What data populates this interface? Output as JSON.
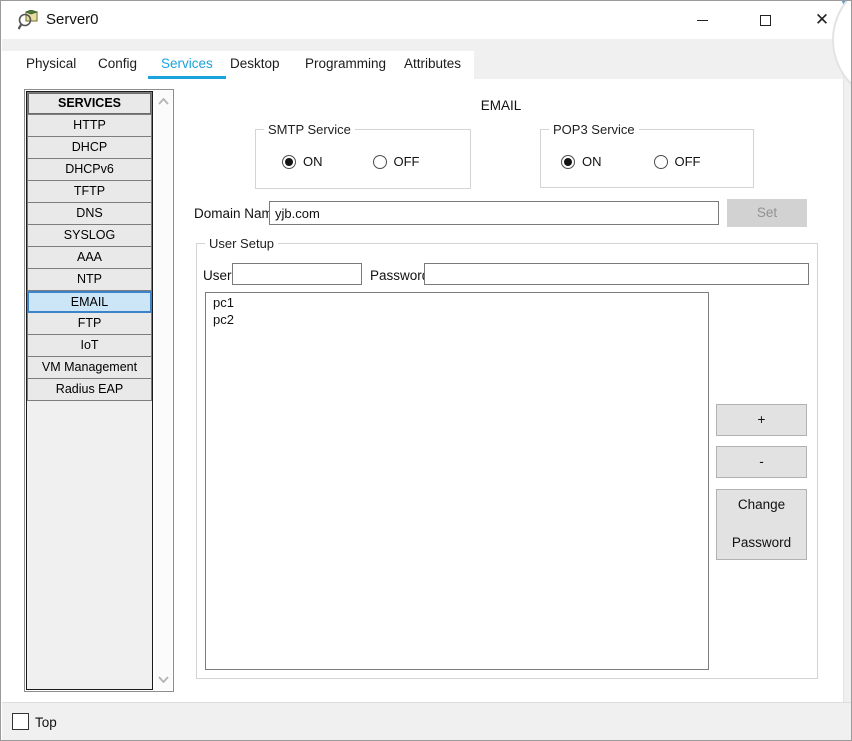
{
  "window": {
    "title": "Server0",
    "footer_checkbox_label": "Top"
  },
  "tabs": [
    {
      "label": "Physical",
      "active": false
    },
    {
      "label": "Config",
      "active": false
    },
    {
      "label": "Services",
      "active": true
    },
    {
      "label": "Desktop",
      "active": false
    },
    {
      "label": "Programming",
      "active": false
    },
    {
      "label": "Attributes",
      "active": false
    }
  ],
  "sidebar": {
    "header": "SERVICES",
    "selected": "EMAIL",
    "items": [
      {
        "label": "HTTP"
      },
      {
        "label": "DHCP"
      },
      {
        "label": "DHCPv6"
      },
      {
        "label": "TFTP"
      },
      {
        "label": "DNS"
      },
      {
        "label": "SYSLOG"
      },
      {
        "label": "AAA"
      },
      {
        "label": "NTP"
      },
      {
        "label": "EMAIL"
      },
      {
        "label": "FTP"
      },
      {
        "label": "IoT"
      },
      {
        "label": "VM Management"
      },
      {
        "label": "Radius EAP"
      }
    ]
  },
  "main": {
    "title": "EMAIL",
    "smtp": {
      "legend": "SMTP Service",
      "on_label": "ON",
      "off_label": "OFF",
      "selected": "ON"
    },
    "pop3": {
      "legend": "POP3 Service",
      "on_label": "ON",
      "off_label": "OFF",
      "selected": "ON"
    },
    "domain": {
      "label": "Domain Name:",
      "value": "yjb.com",
      "set_label": "Set",
      "set_enabled": false
    },
    "user_setup": {
      "legend": "User Setup",
      "user_label": "User",
      "user_value": "",
      "password_label": "Password",
      "password_value": "",
      "users": [
        "pc1",
        "pc2"
      ],
      "add_label": "+",
      "remove_label": "-",
      "change_line1": "Change",
      "change_line2": "Password"
    }
  },
  "colors": {
    "tab_active": "#1aa3dc",
    "selected_item_bg": "#cde6f7",
    "selected_item_border": "#3c83c9",
    "chrome_gray": "#f0f0f0",
    "disabled_button_bg": "#d2d2d2",
    "disabled_button_text": "#929292"
  },
  "icons": {
    "title_icon": "packet-tracer-device-icon",
    "minimize": "minimize-icon",
    "maximize": "maximize-icon",
    "close": "close-icon",
    "scroll_up": "chevron-up-icon",
    "scroll_down": "chevron-down-icon"
  }
}
